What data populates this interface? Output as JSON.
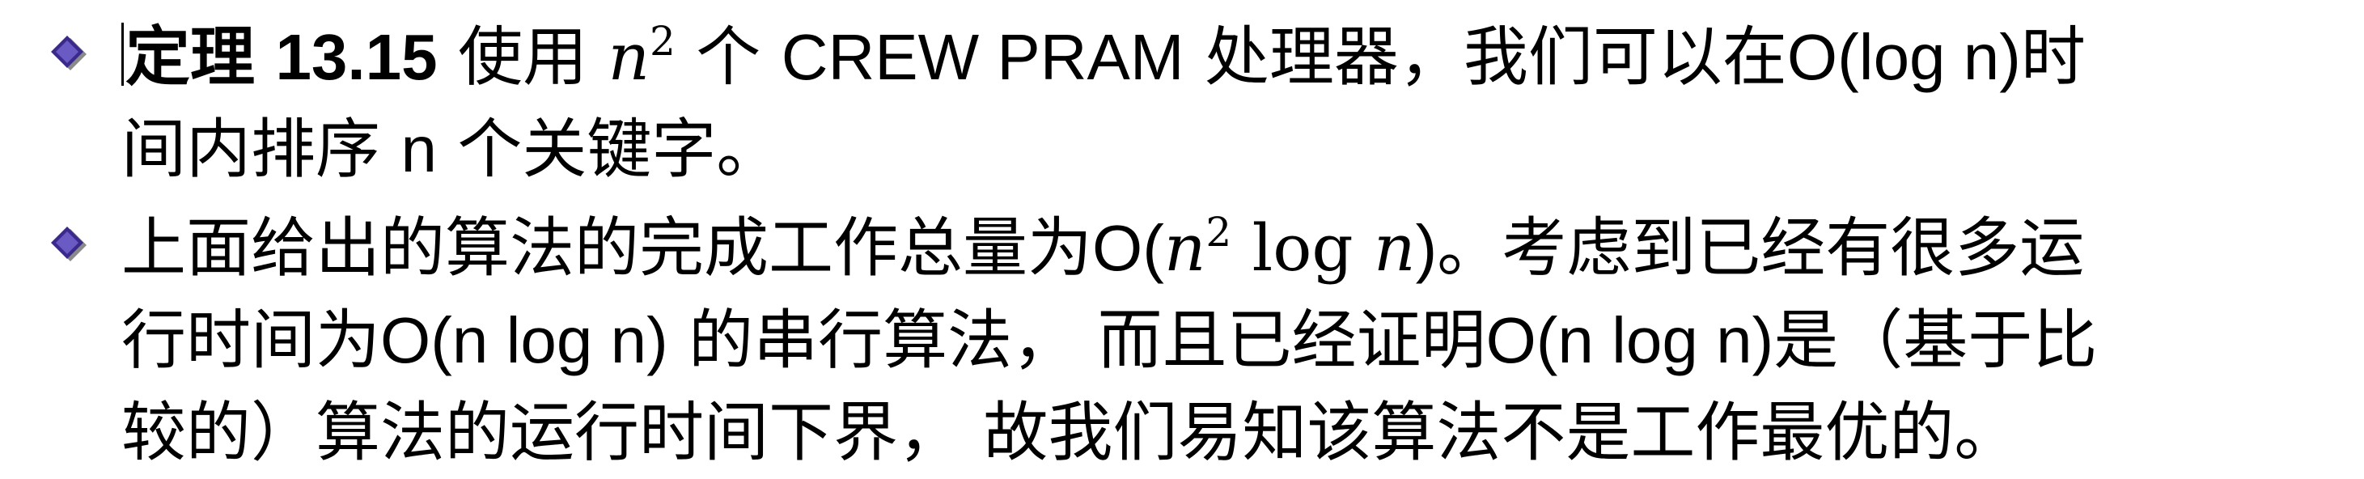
{
  "bullets": [
    {
      "marker_icon": "diamond-bullet-icon",
      "lines": [
        {
          "theorem_label": "定理",
          "theorem_number": "13.15",
          "t1": " 使用 ",
          "var_n": "n",
          "exp_2": "2",
          "t2": " 个 ",
          "t3": "CREW PRAM",
          "t4": " 处理器，我们可以在",
          "t5": "O(log n)",
          "t6": "时"
        },
        {
          "t1": "间内排序 ",
          "t2": "n",
          "t3": " 个关键字。"
        }
      ]
    },
    {
      "marker_icon": "diamond-bullet-icon",
      "lines": [
        {
          "t1": "上面给出的算法的完成工作总量为",
          "t2": "O(",
          "var_n": "n",
          "exp_2": "2",
          "log": " log",
          "var_n2": "n",
          "t3": ")",
          "t4": "。考虑到已经有很多运"
        },
        {
          "t1": "行时间为",
          "t2": "O(n log n)",
          "t3": " 的串行算法， 而且已经证明",
          "t4": "O(n log n)",
          "t5": "是（基于比"
        },
        {
          "t1": "较的）算法的运行时间下界， 故我们易知该算法不是工作最优的。"
        }
      ]
    }
  ],
  "colors": {
    "marker_fill": "#3b2a8c",
    "marker_shadow": "#8a8a8a",
    "text": "#000000"
  }
}
